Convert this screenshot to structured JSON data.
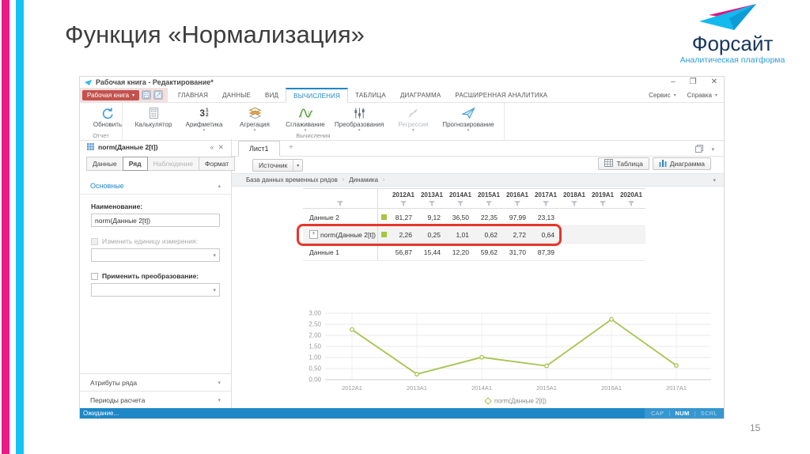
{
  "slide": {
    "title": "Функция «Нормализация»",
    "page_number": "15",
    "accent_pink": "#ec1a87",
    "accent_cyan": "#12c3f4"
  },
  "logo": {
    "name": "Форсайт",
    "subtitle": "Аналитическая платформа"
  },
  "window": {
    "title": "Рабочая книга - Редактирование*",
    "menu_button": "Рабочая книга",
    "tabs": [
      {
        "label": "ГЛАВНАЯ",
        "active": false
      },
      {
        "label": "ДАННЫЕ",
        "active": false
      },
      {
        "label": "ВИД",
        "active": false
      },
      {
        "label": "ВЫЧИСЛЕНИЯ",
        "active": true
      },
      {
        "label": "ТАБЛИЦА",
        "active": false
      },
      {
        "label": "ДИАГРАММА",
        "active": false
      },
      {
        "label": "РАСШИРЕННАЯ АНАЛИТИКА",
        "active": false
      }
    ],
    "right_menus": [
      "Сервис",
      "Справка"
    ]
  },
  "ribbon": {
    "groups": [
      "Отчет",
      "Вычисления"
    ],
    "buttons": [
      {
        "label": "Обновить",
        "icon": "refresh",
        "group": 0,
        "caret": false,
        "disabled": false
      },
      {
        "label": "Калькулятор",
        "icon": "calculator",
        "group": 1,
        "caret": false,
        "disabled": false
      },
      {
        "label": "Арифметика",
        "icon": "arithmetic",
        "group": 1,
        "caret": true,
        "disabled": false
      },
      {
        "label": "Агрегация",
        "icon": "aggregation",
        "group": 1,
        "caret": true,
        "disabled": false
      },
      {
        "label": "Сглаживание",
        "icon": "smoothing",
        "group": 1,
        "caret": true,
        "disabled": false
      },
      {
        "label": "Преобразования",
        "icon": "transformations",
        "group": 1,
        "caret": true,
        "disabled": false
      },
      {
        "label": "Регрессия",
        "icon": "regression",
        "group": 1,
        "caret": true,
        "disabled": true
      },
      {
        "label": "Прогнозирование",
        "icon": "forecasting",
        "group": 1,
        "caret": true,
        "disabled": false
      }
    ]
  },
  "sidebar": {
    "header": "norm(Данные 2[t])",
    "tabs": [
      {
        "label": "Данные",
        "active": false,
        "disabled": false
      },
      {
        "label": "Ряд",
        "active": true,
        "disabled": false
      },
      {
        "label": "Наблюдение",
        "active": false,
        "disabled": true
      },
      {
        "label": "Формат",
        "active": false,
        "disabled": false
      }
    ],
    "section": "Основные",
    "fields": {
      "name_label": "Наименование:",
      "name_value": "norm(Данные 2[t])",
      "unit_label": "Изменить единицу измерения:",
      "transform_label": "Применить преобразование:"
    },
    "bottom_sections": [
      "Атрибуты ряда",
      "Периоды расчета"
    ]
  },
  "workspace": {
    "sheet_tab": "Лист1",
    "add_label": "+",
    "source_button": "Источник",
    "view_buttons": [
      {
        "label": "Таблица"
      },
      {
        "label": "Диаграмма"
      }
    ],
    "breadcrumb": [
      "База данных временных рядов",
      "Динамика"
    ]
  },
  "table": {
    "columns": [
      "2012A1",
      "2013A1",
      "2014A1",
      "2015A1",
      "2016A1",
      "2017A1",
      "2018A1",
      "2019A1",
      "2020A1"
    ],
    "rows": [
      {
        "label": "Данные 2",
        "indicator": true,
        "expandable": false,
        "highlighted": false,
        "values": [
          "81,27",
          "9,12",
          "36,50",
          "22,35",
          "97,99",
          "23,13",
          "",
          "",
          ""
        ]
      },
      {
        "label": "norm(Данные 2[t])",
        "indicator": true,
        "expandable": true,
        "highlighted": true,
        "values": [
          "2,26",
          "0,25",
          "1,01",
          "0,62",
          "2,72",
          "0,64",
          "",
          "",
          ""
        ]
      },
      {
        "label": "Данные 1",
        "indicator": false,
        "expandable": false,
        "highlighted": false,
        "values": [
          "56,87",
          "15,44",
          "12,20",
          "59,62",
          "31,70",
          "87,39",
          "",
          "",
          ""
        ]
      }
    ],
    "indicator_color": "#a5c63b",
    "highlight_color": "#e6362a"
  },
  "chart_data": {
    "type": "line",
    "title": "",
    "x": [
      "2012A1",
      "2013A1",
      "2014A1",
      "2015A1",
      "2016A1",
      "2017A1"
    ],
    "series": [
      {
        "name": "norm(Данные 2[t])",
        "values": [
          2.26,
          0.25,
          1.01,
          0.62,
          2.72,
          0.64
        ],
        "color": "#a6c44e"
      }
    ],
    "ylim": [
      0,
      3
    ],
    "yticks": [
      "0,00",
      "0,50",
      "1,00",
      "1,50",
      "2,00",
      "2,50",
      "3,00"
    ],
    "grid": true,
    "legend_position": "bottom"
  },
  "statusbar": {
    "text": "Ожидание...",
    "indicators": [
      {
        "label": "CAP",
        "active": false
      },
      {
        "label": "NUM",
        "active": true
      },
      {
        "label": "SCRL",
        "active": false
      }
    ]
  }
}
